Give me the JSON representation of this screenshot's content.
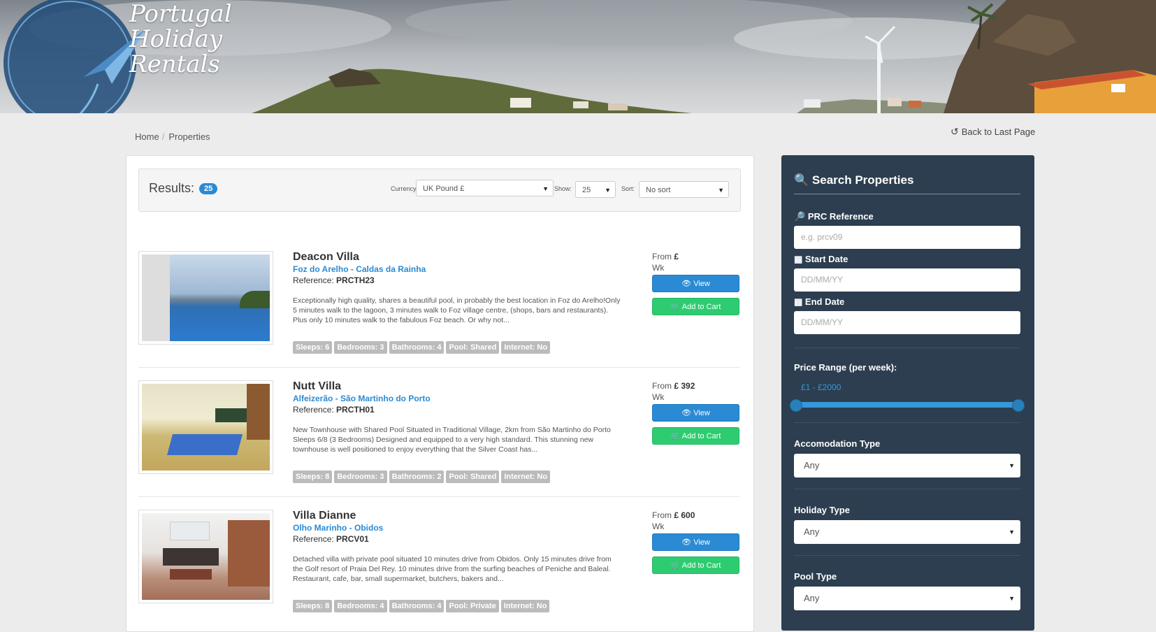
{
  "header": {
    "logo_lines": [
      "Portugal",
      "Holiday",
      "Rentals"
    ]
  },
  "breadcrumb": {
    "items": [
      "Home",
      "Properties"
    ],
    "separator": "/"
  },
  "back_link": "Back to Last Page",
  "results": {
    "label": "Results:",
    "count": "25",
    "currency_label": "Currency:",
    "currency_value": "UK Pound £",
    "show_label": "Show:",
    "show_value": "25",
    "sort_label": "Sort:",
    "sort_value": "No sort"
  },
  "properties": [
    {
      "title": "Deacon Villa",
      "location": "Foz do Arelho - Caldas da Rainha",
      "ref_label": "Reference:",
      "reference": "PRCTH23",
      "description": "Exceptionally high quality, shares a beautiful pool, in probably the best location in Foz do Arelho!Only 5 minutes walk to the lagoon, 3 minutes walk to Foz village centre, (shops, bars and restaurants). Plus only 10 minutes walk to the fabulous Foz beach. Or why not...",
      "tags": [
        "Sleeps: 6",
        "Bedrooms: 3",
        "Bathrooms: 4",
        "Pool: Shared",
        "Internet: No"
      ],
      "price_from": "From",
      "price": "£",
      "per": "Wk",
      "view_label": "View",
      "cart_label": "Add to Cart"
    },
    {
      "title": "Nutt Villa",
      "location": "Alfeizerão - São Martinho do Porto",
      "ref_label": "Reference:",
      "reference": "PRCTH01",
      "description": "New Townhouse with Shared Pool Situated in Traditional Village, 2km from São Martinho do Porto Sleeps 6/8 (3 Bedrooms) Designed and equipped to a very high standard. This stunning new townhouse is well positioned to enjoy everything that the Silver Coast has...",
      "tags": [
        "Sleeps: 8",
        "Bedrooms: 3",
        "Bathrooms: 2",
        "Pool: Shared",
        "Internet: No"
      ],
      "price_from": "From",
      "price": "£ 392",
      "per": "Wk",
      "view_label": "View",
      "cart_label": "Add to Cart"
    },
    {
      "title": "Villa Dianne",
      "location": "Olho Marinho - Obidos",
      "ref_label": "Reference:",
      "reference": "PRCV01",
      "description": "Detached villa with private pool situated 10 minutes drive from Obidos. Only 15 minutes drive from the Golf resort of Praia Del Rey. 10 minutes drive from the surfing beaches of Peniche and Baleal. Restaurant, cafe, bar, small supermarket, butchers, bakers and...",
      "tags": [
        "Sleeps: 8",
        "Bedrooms: 4",
        "Bathrooms: 4",
        "Pool: Private",
        "Internet: No"
      ],
      "price_from": "From",
      "price": "£ 600",
      "per": "Wk",
      "view_label": "View",
      "cart_label": "Add to Cart"
    }
  ],
  "search": {
    "title": "Search Properties",
    "prc_label": "PRC Reference",
    "prc_placeholder": "e.g. prcv09",
    "start_label": "Start Date",
    "start_placeholder": "DD/MM/YY",
    "end_label": "End Date",
    "end_placeholder": "DD/MM/YY",
    "price_label": "Price Range (per week):",
    "price_range": "£1 - £2000",
    "price_min_fraction": 0,
    "price_max_fraction": 1,
    "accom_label": "Accomodation Type",
    "accom_value": "Any",
    "holiday_label": "Holiday Type",
    "holiday_value": "Any",
    "pool_label": "Pool Type",
    "pool_value": "Any"
  },
  "colors": {
    "accent": "#2a8ad4",
    "cart": "#2ecc71",
    "sidebar": "#2c3e50",
    "tag": "#bbbbbb"
  }
}
